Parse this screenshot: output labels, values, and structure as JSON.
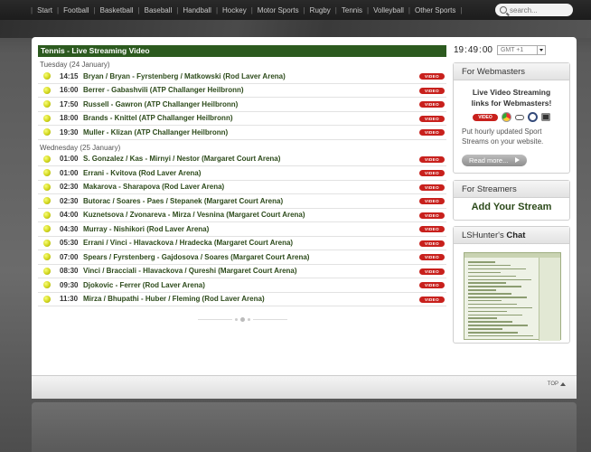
{
  "nav": {
    "links": [
      "Start",
      "Football",
      "Basketball",
      "Baseball",
      "Handball",
      "Hockey",
      "Motor Sports",
      "Rugby",
      "Tennis",
      "Volleyball",
      "Other Sports"
    ],
    "search_placeholder": "search..."
  },
  "main": {
    "title": "Tennis - Live Streaming Video",
    "badge_label": "VIDEO",
    "days": [
      {
        "label": "Tuesday (24 January)",
        "matches": [
          {
            "time": "14:15",
            "name": "Bryan / Bryan - Fyrstenberg / Matkowski (Rod Laver Arena)"
          },
          {
            "time": "16:00",
            "name": "Berrer - Gabashvili (ATP Challanger Heilbronn)"
          },
          {
            "time": "17:50",
            "name": "Russell - Gawron (ATP Challanger Heilbronn)"
          },
          {
            "time": "18:00",
            "name": "Brands - Knittel (ATP Challanger Heilbronn)"
          },
          {
            "time": "19:30",
            "name": "Muller - Klizan (ATP Challanger Heilbronn)"
          }
        ]
      },
      {
        "label": "Wednesday (25 January)",
        "matches": [
          {
            "time": "01:00",
            "name": "S. Gonzalez / Kas - Mirnyi / Nestor (Margaret Court Arena)"
          },
          {
            "time": "01:00",
            "name": "Errani - Kvitova (Rod Laver Arena)"
          },
          {
            "time": "02:30",
            "name": "Makarova - Sharapova (Rod Laver Arena)"
          },
          {
            "time": "02:30",
            "name": "Butorac / Soares - Paes / Stepanek (Margaret Court Arena)"
          },
          {
            "time": "04:00",
            "name": "Kuznetsova / Zvonareva - Mirza / Vesnina (Margaret Court Arena)"
          },
          {
            "time": "04:30",
            "name": "Murray - Nishikori (Rod Laver Arena)"
          },
          {
            "time": "05:30",
            "name": "Errani / Vinci - Hlavackova / Hradecka (Margaret Court Arena)"
          },
          {
            "time": "07:00",
            "name": "Spears / Fyrstenberg - Gajdosova / Soares (Margaret Court Arena)"
          },
          {
            "time": "08:30",
            "name": "Vinci / Bracciali - Hlavackova / Qureshi (Margaret Court Arena)"
          },
          {
            "time": "09:30",
            "name": "Djokovic - Ferrer (Rod Laver Arena)"
          },
          {
            "time": "11:30",
            "name": "Mirza / Bhupathi - Huber / Fleming (Rod Laver Arena)"
          }
        ]
      }
    ]
  },
  "clock": {
    "h": "19",
    "m": "49",
    "s": "00",
    "tz": "GMT +1"
  },
  "webmasters": {
    "head": "For Webmasters",
    "title_line1": "Live Video Streaming",
    "title_line2": "links for Webmasters!",
    "text": "Put hourly updated Sport Streams on your website.",
    "read_more": "Read more..."
  },
  "streamers": {
    "head": "For Streamers",
    "link": "Add Your Stream"
  },
  "chat": {
    "head_prefix": "LSHunter's ",
    "head_bold": "Chat"
  },
  "footer": {
    "top_label": "TOP"
  },
  "colors": {
    "accent_green": "#2c5a1f",
    "video_red": "#c8201c"
  }
}
